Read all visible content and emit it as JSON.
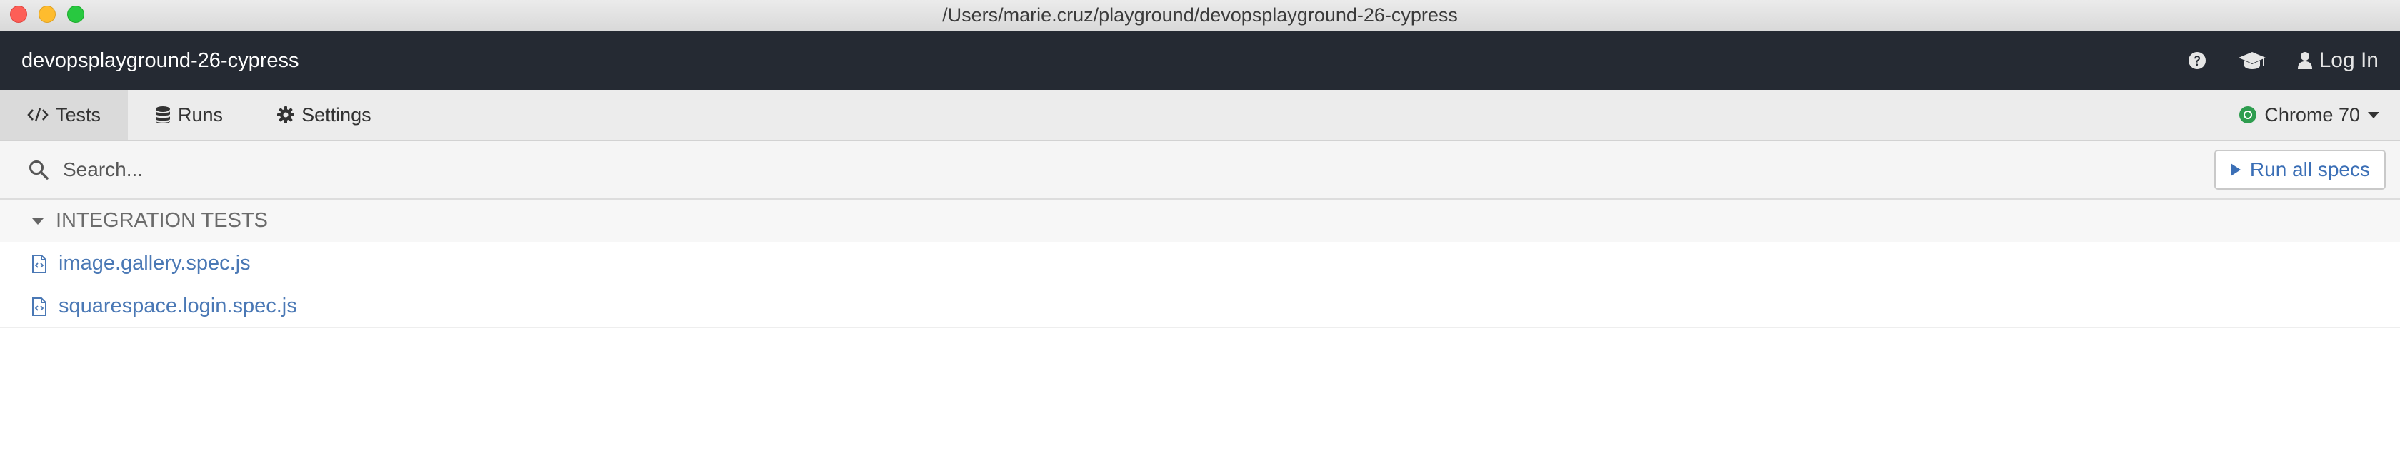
{
  "window": {
    "title": "/Users/marie.cruz/playground/devopsplayground-26-cypress"
  },
  "header": {
    "project_name": "devopsplayground-26-cypress",
    "help_icon": "question-circle-icon",
    "docs_icon": "graduation-cap-icon",
    "login_label": "Log In",
    "login_icon": "user-icon",
    "background": "#252a33"
  },
  "tabs": [
    {
      "label": "Tests",
      "icon": "code-icon",
      "active": true
    },
    {
      "label": "Runs",
      "icon": "database-icon",
      "active": false
    },
    {
      "label": "Settings",
      "icon": "gear-icon",
      "active": false
    }
  ],
  "browser": {
    "label": "Chrome 70",
    "icon": "chrome-icon"
  },
  "search": {
    "placeholder": "Search...",
    "value": ""
  },
  "run_all": {
    "label": "Run all specs",
    "icon": "play-icon",
    "color": "#3b6fb6"
  },
  "section": {
    "label": "INTEGRATION TESTS",
    "icon": "caret-down-icon"
  },
  "specs": [
    {
      "name": "image.gallery.spec.js",
      "icon": "file-code-icon"
    },
    {
      "name": "squarespace.login.spec.js",
      "icon": "file-code-icon"
    }
  ]
}
